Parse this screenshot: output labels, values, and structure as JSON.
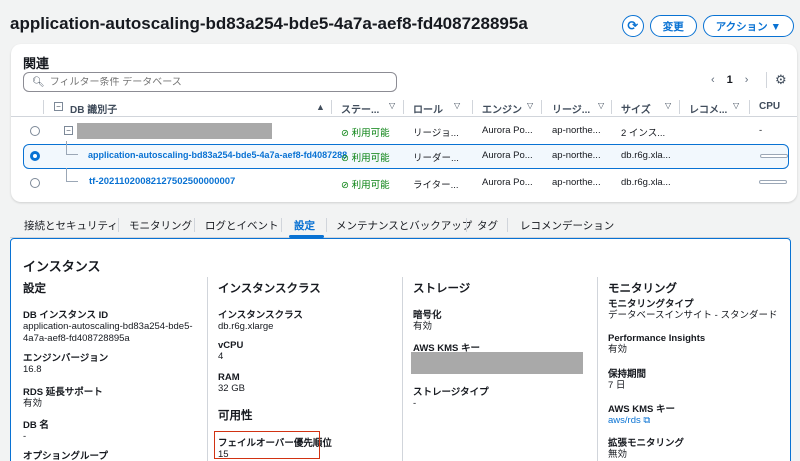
{
  "header": {
    "title": "application-autoscaling-bd83a254-bde5-4a7a-aef8-fd408728895a",
    "refresh_icon": "refresh-icon",
    "modify_label": "変更",
    "actions_label": "アクション ▼"
  },
  "related": {
    "title": "関連",
    "search_placeholder": "フィルター条件 データベース",
    "page": "1",
    "columns": [
      "DB 識別子",
      "ステー...",
      "ロール",
      "エンジン",
      "リージ...",
      "サイズ",
      "レコメ...",
      "CPU"
    ],
    "rows": [
      {
        "id": "",
        "status": "利用可能",
        "role": "リージョ...",
        "engine": "Aurora Po...",
        "region": "ap-northe...",
        "size": "2 インス...",
        "cpu": "-",
        "selected": false
      },
      {
        "id": "application-autoscaling-bd83a254-bde5-4a7a-aef8-fd4087288",
        "status": "利用可能",
        "role": "リーダー...",
        "engine": "Aurora Po...",
        "region": "ap-northe...",
        "size": "db.r6g.xla...",
        "cpu": "",
        "selected": true
      },
      {
        "id": "tf-20211020082127502500000007",
        "status": "利用可能",
        "role": "ライター...",
        "engine": "Aurora Po...",
        "region": "ap-northe...",
        "size": "db.r6g.xla...",
        "cpu": "",
        "selected": false
      }
    ]
  },
  "tabs": [
    "接続とセキュリティ",
    "モニタリング",
    "ログとイベント",
    "設定",
    "メンテナンスとバックアップ",
    "タグ",
    "レコメンデーション"
  ],
  "active_tab": "設定",
  "instance": {
    "title": "インスタンス",
    "config": {
      "heading": "設定",
      "db_instance_id_label": "DB インスタンス ID",
      "db_instance_id_value_1": "application-autoscaling-bd83a254-bde5-",
      "db_instance_id_value_2": "4a7a-aef8-fd408728895a",
      "engine_version_label": "エンジンバージョン",
      "engine_version_value": "16.8",
      "rds_ext_label": "RDS 延長サポート",
      "rds_ext_value": "有効",
      "db_name_label": "DB 名",
      "db_name_value": "-",
      "option_group_label": "オプショングループ"
    },
    "instance_class": {
      "heading": "インスタンスクラス",
      "class_label": "インスタンスクラス",
      "class_value": "db.r6g.xlarge",
      "vcpu_label": "vCPU",
      "vcpu_value": "4",
      "ram_label": "RAM",
      "ram_value": "32 GB",
      "availability_heading": "可用性",
      "failover_label": "フェイルオーバー優先順位",
      "failover_value": "15"
    },
    "storage": {
      "heading": "ストレージ",
      "encryption_label": "暗号化",
      "encryption_value": "有効",
      "kms_label": "AWS KMS キー",
      "storage_type_label": "ストレージタイプ",
      "storage_type_value": "-"
    },
    "monitoring": {
      "heading": "モニタリング",
      "type_label": "モニタリングタイプ",
      "type_value": "データベースインサイト - スタンダード",
      "pi_label": "Performance Insights",
      "pi_value": "有効",
      "retention_label": "保持期間",
      "retention_value": "7 日",
      "kms_label": "AWS KMS キー",
      "kms_value": "aws/rds",
      "enhanced_label": "拡張モニタリング",
      "enhanced_value": "無効"
    }
  }
}
